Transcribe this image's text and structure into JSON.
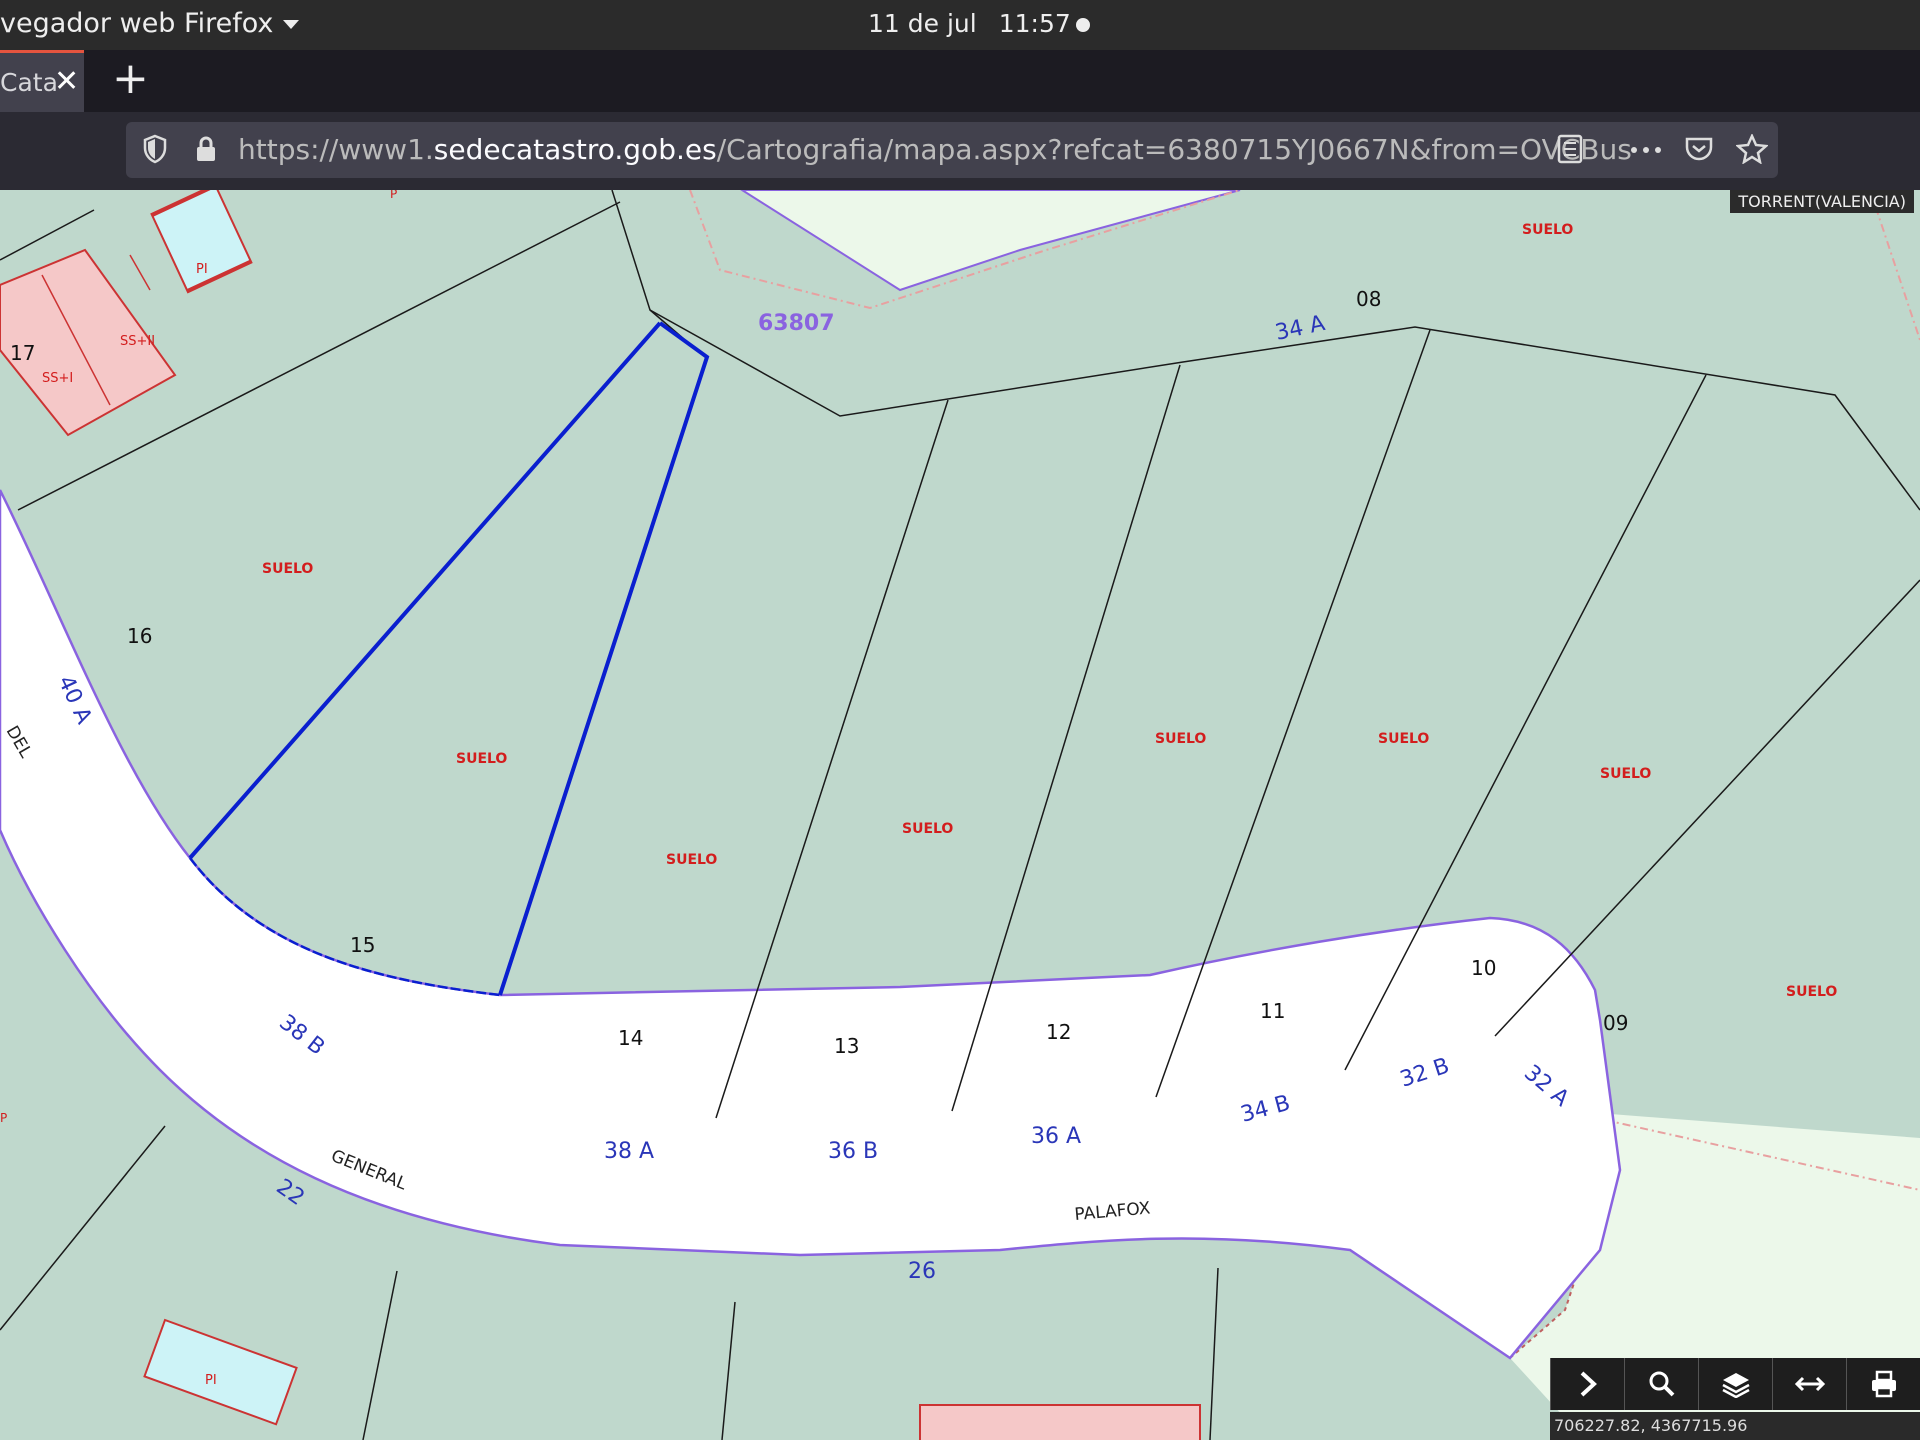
{
  "system_bar": {
    "app_name": "vegador web Firefox",
    "date": "11 de jul",
    "time": "11:57"
  },
  "browser": {
    "tab_title": "Cata",
    "url_prefix": "https://www1.",
    "url_domain": "sedecatastro.gob.es",
    "url_path": "/Cartografia/mapa.aspx?refcat=6380715YJ0667N&from=OVCBus",
    "icons": [
      "shield-icon",
      "lock-icon",
      "reader-view-icon",
      "more-icon",
      "pocket-icon",
      "bookmark-star-icon"
    ]
  },
  "map": {
    "location_badge": "TORRENT(VALENCIA)",
    "block_number": "63807",
    "coordinates": "706227.82, 4367715.96",
    "colors": {
      "parcel": "#bfd8cc",
      "street": "#ffffff",
      "selected_outline": "#0a1fcf",
      "building": "#f5c8c8",
      "pool": "#cdf3f7",
      "boundary_purple": "#8a63e0",
      "label_red": "#d31d1d",
      "label_blue": "#2a36b8"
    },
    "suelo_label": "SUELO",
    "parcel_numbers": [
      "17",
      "16",
      "15",
      "14",
      "13",
      "12",
      "11",
      "10",
      "09",
      "08"
    ],
    "house_numbers": [
      "40 A",
      "38 B",
      "38 A",
      "36 B",
      "36 A",
      "34 B",
      "32 B",
      "32 A",
      "34 A",
      "26",
      "22"
    ],
    "street_words": [
      "DEL",
      "GENERAL",
      "PALAFOX"
    ],
    "building_labels": [
      "SS+II",
      "SS+I",
      "PI",
      "PI"
    ]
  },
  "map_toolbar": {
    "buttons": [
      "chevron-right-icon",
      "search-icon",
      "layers-icon",
      "measure-icon",
      "print-icon"
    ]
  }
}
